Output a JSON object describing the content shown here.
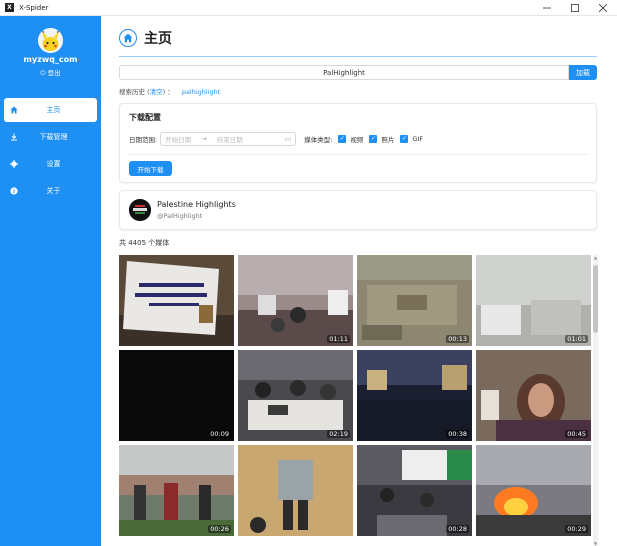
{
  "window": {
    "title": "X-Spider"
  },
  "sidebar": {
    "username": "myzwq_com",
    "logout_label": "登出",
    "items": [
      {
        "label": "主页",
        "icon": "home-icon",
        "active": true
      },
      {
        "label": "下载管理",
        "icon": "download-icon",
        "active": false
      },
      {
        "label": "设置",
        "icon": "gear-icon",
        "active": false
      },
      {
        "label": "关于",
        "icon": "info-icon",
        "active": false
      }
    ]
  },
  "main": {
    "title": "主页",
    "search": {
      "value": "PalHighlight",
      "button_label": "加载"
    },
    "history": {
      "label": "搜索历史",
      "clear_label": "清空",
      "colon": "：",
      "items": [
        "palhighlight"
      ]
    },
    "download": {
      "title": "下载配置",
      "date_label": "日期范围:",
      "start_placeholder": "开始日期",
      "end_placeholder": "结束日期",
      "media_type_label": "媒体类型:",
      "types": [
        "视频",
        "照片",
        "GIF"
      ],
      "start_button": "开始下载"
    },
    "profile": {
      "name": "Palestine Highlights",
      "handle": "@PalHighlight"
    },
    "media_count": "共 4405 个媒体",
    "tiles": [
      {
        "duration": ""
      },
      {
        "duration": "01:11"
      },
      {
        "duration": "00:13"
      },
      {
        "duration": "01:01"
      },
      {
        "duration": "00:09"
      },
      {
        "duration": "02:19"
      },
      {
        "duration": "00:38"
      },
      {
        "duration": "00:45"
      },
      {
        "duration": "00:26"
      },
      {
        "duration": ""
      },
      {
        "duration": "00:28"
      },
      {
        "duration": "00:29"
      }
    ]
  },
  "colors": {
    "accent": "#1e8ff3",
    "sidebar_bg": "#1e8ff3"
  }
}
